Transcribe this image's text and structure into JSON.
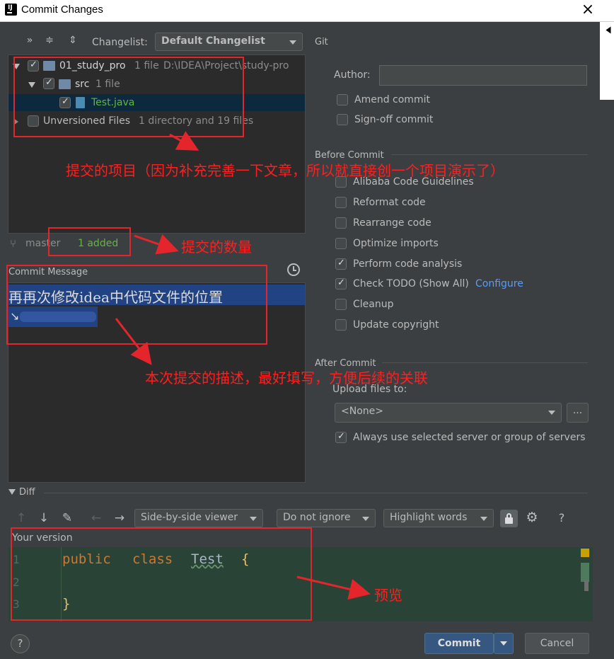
{
  "window": {
    "title": "Commit Changes",
    "close_glyph": "×"
  },
  "toolbar": {
    "changelist_label": "Changelist:",
    "changelist_value": "Default Changelist",
    "git_label": "Git"
  },
  "tree": {
    "root": {
      "name": "01_study_pro",
      "count": "1 file",
      "path": "D:\\IDEA\\Project\\study-pro"
    },
    "src": {
      "name": "src",
      "count": "1 file"
    },
    "file": {
      "name": "Test.java"
    },
    "unversioned": {
      "name": "Unversioned Files",
      "count": "1 directory and 19 files"
    }
  },
  "status": {
    "branch": "master",
    "added": "1 added"
  },
  "commit_message": {
    "label": "Commit Message",
    "text": "再再次修改idea中代码文件的位置",
    "line2": "↘"
  },
  "git": {
    "author_label": "Author:",
    "author_value": "",
    "amend": "Amend commit",
    "signoff": "Sign-off commit"
  },
  "before_commit": {
    "title": "Before Commit",
    "options": [
      {
        "label": "Alibaba Code Guidelines",
        "checked": false
      },
      {
        "label": "Reformat code",
        "checked": false
      },
      {
        "label": "Rearrange code",
        "checked": false
      },
      {
        "label": "Optimize imports",
        "checked": false
      },
      {
        "label": "Perform code analysis",
        "checked": true
      },
      {
        "label": "Check TODO (Show All)",
        "checked": true,
        "link": "Configure"
      },
      {
        "label": "Cleanup",
        "checked": false
      },
      {
        "label": "Update copyright",
        "checked": false
      }
    ]
  },
  "after_commit": {
    "title": "After Commit",
    "upload_label": "Upload files to:",
    "upload_value": "<None>",
    "browse": "...",
    "always_use": "Always use selected server or group of servers"
  },
  "diff": {
    "title": "Diff",
    "viewer": "Side-by-side viewer",
    "ignore": "Do not ignore",
    "highlight": "Highlight words",
    "help": "?",
    "your_version": "Your version",
    "lines": [
      {
        "num": "1",
        "kw1": "public",
        "kw2": "class",
        "name": "Test",
        "brace": "{"
      },
      {
        "num": "2"
      },
      {
        "num": "3",
        "brace": "}"
      }
    ]
  },
  "footer": {
    "help": "?",
    "commit": "Commit",
    "cancel": "Cancel"
  },
  "annotations": {
    "a1": "提交的项目（因为补充完善一下文章，所以就直接创一个项目演示了）",
    "a2": "提交的数量",
    "a3": "本次提交的描述，最好填写，方便后续的关联",
    "a4": "预览"
  },
  "colors": {
    "accent_blue": "#589df6",
    "added_green": "#62b543",
    "annotation_red": "#ff1f1f",
    "diff_bg": "#294436"
  }
}
